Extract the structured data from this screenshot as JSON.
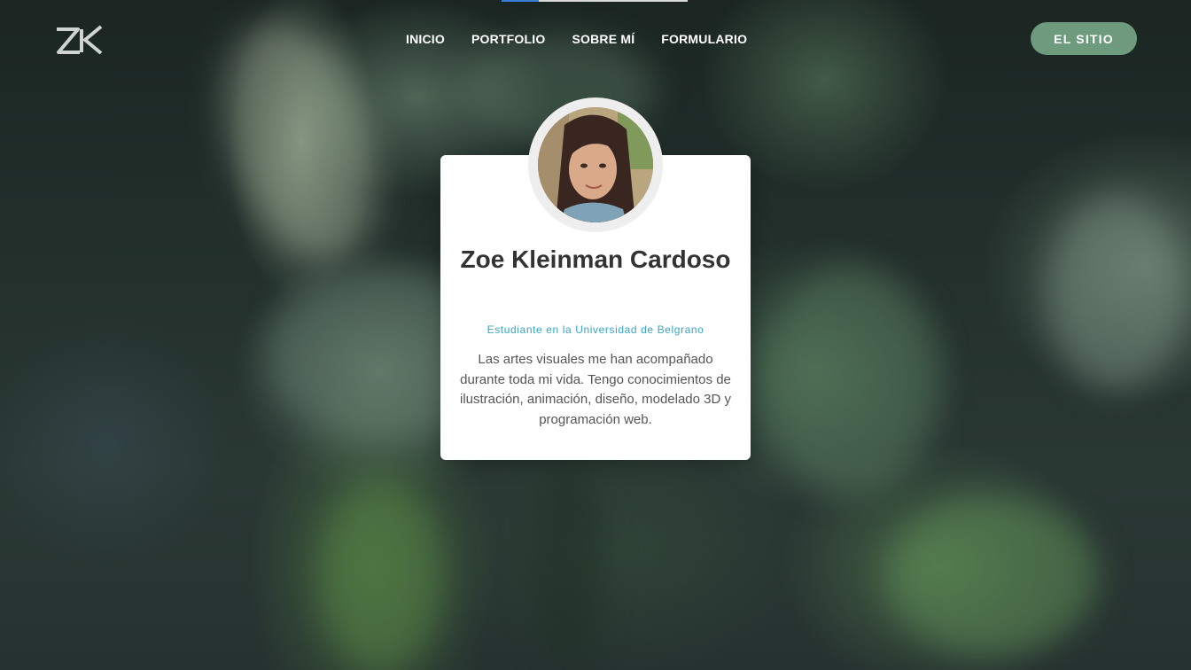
{
  "header": {
    "logo_text": "ZK",
    "nav": [
      {
        "label": "INICIO"
      },
      {
        "label": "PORTFOLIO"
      },
      {
        "label": "SOBRE MÍ"
      },
      {
        "label": "FORMULARIO"
      }
    ],
    "cta_label": "EL SITIO"
  },
  "profile": {
    "name": "Zoe Kleinman Cardoso",
    "subtitle": "Estudiante en la Universidad de Belgrano",
    "bio": "Las artes visuales me han acompañado durante toda mi vida. Tengo conocimientos de ilustración, animación, diseño, modelado 3D y programación web."
  },
  "colors": {
    "cta_background": "#6e9a7e",
    "subtitle": "#35a6c8",
    "name": "#333333",
    "bio": "#555555"
  },
  "icons": {
    "logo": "zk-logo-icon",
    "avatar": "profile-photo"
  }
}
